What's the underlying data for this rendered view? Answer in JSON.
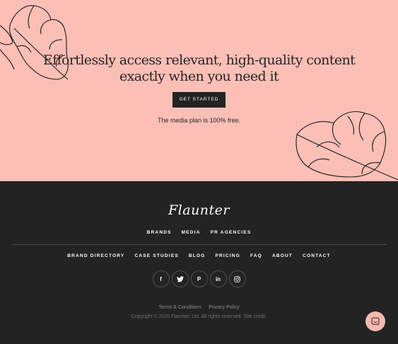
{
  "hero": {
    "title_line1": "Effortlessly access relevant, high-quality content",
    "title_line2": "exactly when you need it",
    "cta_label": "GET STARTED",
    "note": "The media plan is 100% free."
  },
  "footer": {
    "logo_text": "Flaunter",
    "primary_nav": [
      "BRANDS",
      "MEDIA",
      "PR AGENCIES"
    ],
    "secondary_nav": [
      "BRAND DIRECTORY",
      "CASE STUDIES",
      "BLOG",
      "PRICING",
      "FAQ",
      "ABOUT",
      "CONTACT"
    ],
    "social": [
      {
        "icon": "facebook-icon",
        "glyph": "f"
      },
      {
        "icon": "twitter-icon",
        "glyph": "🐦"
      },
      {
        "icon": "pinterest-icon",
        "glyph": "P"
      },
      {
        "icon": "linkedin-icon",
        "glyph": "in"
      },
      {
        "icon": "instagram-icon",
        "glyph": "◎"
      }
    ],
    "legal_links": [
      "Terms & Conditions",
      "Privacy Policy"
    ],
    "copyright": "Copyright © 2020 Flaunter. Ltd. All rights reserved. Site credit."
  },
  "colors": {
    "hero_bg": "#fbbfb6",
    "footer_bg": "#232323",
    "chat_button": "#f6b9b0"
  },
  "chat": {
    "icon": "chat-icon"
  }
}
